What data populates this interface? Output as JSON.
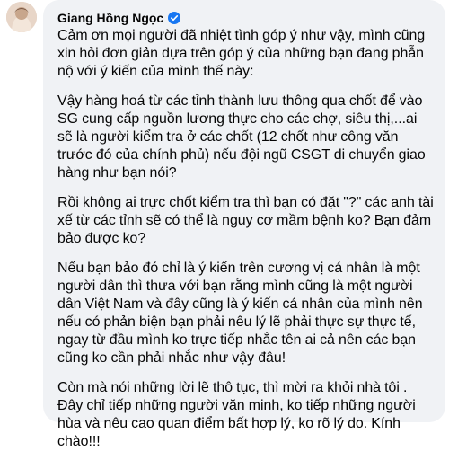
{
  "author": {
    "name": "Giang Hồng Ngọc",
    "avatar_icon": "avatar-photo",
    "verified_icon": "verified-badge-icon",
    "accent_color": "#1877f2"
  },
  "comment": {
    "bubble_color": "#f0f2f5",
    "paragraphs": [
      "Cảm ơn mọi người đã nhiệt tình góp ý như vậy, mình cũng xin hỏi đơn giản dựa trên góp ý của những bạn đang phẫn nộ với ý kiến của mình thế này:",
      "Vậy hàng hoá từ các tỉnh thành lưu thông qua chốt để vào SG cung cấp nguồn lương thực cho các chợ, siêu thị,...ai sẽ là người kiểm tra ở các chốt (12 chốt như công văn trước đó của chính phủ) nếu đội ngũ CSGT di chuyển giao hàng như bạn nói?",
      "Rồi không ai trực chốt kiểm tra thì bạn có đặt \"?\" các anh tài xế từ các tỉnh sẽ có thể là nguy cơ mầm bệnh ko? Bạn đảm bảo được ko?",
      "Nếu bạn bảo đó chỉ là ý kiến trên cương vị cá nhân là một người dân thì thưa với bạn rằng mình cũng là một người dân Việt Nam và đây cũng là ý kiến cá nhân của mình nên nếu có phản biện bạn phải nêu lý lẽ phải thực sự thực tế, ngay từ đầu mình ko trực tiếp nhắc tên ai cả nên các bạn cũng ko cần phải nhắc như vậy đâu!",
      "Còn mà nói những lời lẽ thô tục, thì mời ra khỏi nhà tôi . Đây chỉ tiếp những người văn minh, ko tiếp những người hùa và nêu cao quan điểm bất hợp lý, ko rõ lý do. Kính chào!!!"
    ]
  }
}
